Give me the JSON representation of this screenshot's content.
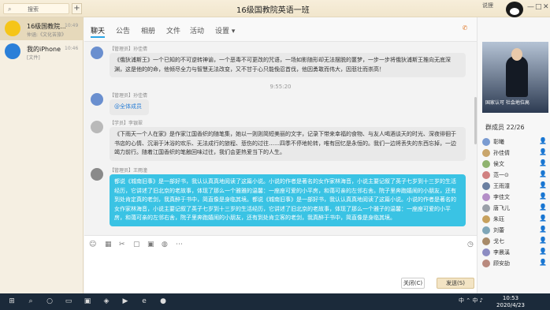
{
  "titlebar": {
    "search_icon": "search-icon",
    "search_placeholder": "搜索",
    "plus": "+",
    "title": "16级国教院英语一班",
    "profile_label": "说狸",
    "minimize": "—",
    "maximize": "□",
    "close": "✕"
  },
  "sidebar": {
    "items": [
      {
        "name": "16级国教院...",
        "sub": "仲涵:《文化苦旅》",
        "time": "10:49",
        "avatar": "#f5c518"
      },
      {
        "name": "我的iPhone",
        "sub": "[文件]",
        "time": "10:46",
        "avatar": "#2b7fd8"
      }
    ]
  },
  "header": {
    "tabs": [
      "聊天",
      "公告",
      "相册",
      "文件",
      "活动",
      "设置 ▾"
    ],
    "icons": [
      {
        "name": "phone-icon",
        "glyph": "✆",
        "color": "#e07a2b"
      },
      {
        "name": "screen-share-icon",
        "glyph": "▭",
        "color": "#e07a2b"
      },
      {
        "name": "homework-icon",
        "glyph": "课",
        "color": "#ffffff"
      },
      {
        "name": "add-icon",
        "glyph": "+",
        "color": "#ffffff"
      },
      {
        "name": "more-icon",
        "glyph": "⋯",
        "color": "#555555"
      }
    ]
  },
  "chat": {
    "messages": [
      {
        "role": "【管理员】孙佳倩",
        "text": "《俄狄浦斯王》一个已知的不可逆转神谕，一个恶毒不可更改的咒语，一场如影随形却无法摆脱的噩梦，一步一步将俄狄浦斯王推向无底深渊，这是他的的命，他倾尽全力与智慧无法改变，又不甘于心只能俛忍首伐，他因勇敢而伟大，因悲壮而崇高！",
        "style": "gray"
      },
      {
        "role": "【管理员】孙佳倩",
        "text": "@全体成员",
        "style": "link"
      },
      {
        "role": "【学员】李银翠",
        "text": "《下雨天一个人在家》是作家江国香织的随笔集，她以一则则简短美丽的文字，记录下带来幸福的食物、与友人喝酒谈天的时光、深夜徘徊于书店的心情、沉溺于沐浴的欢乐、无法成行的旅程、悲伤的过往……四季不停地轮转，唯有回忆是永恒的。我们一边将丢失的东西忘掉，一边竭力前行。随着江国香织的笔触回味过往，我们会更热爱当下的人生。",
        "style": "gray"
      },
      {
        "role": "【管理员】王雨潼",
        "text": "都说《城南旧事》是一部好书，我认认真真地阅读了这篇小说。小说的作者是著名的女作家林海音，小说主要记叙了英子七岁到十三岁的生活经历，它讲述了旧北京的老故事，体现了那么一个雅雅的温馨：一座座可爱的小平房，和蔼可亲的左邻右舍。院子里奔跑嬉闹的小朋友，还有到处肯定真的老剑，我真醉于书中，简直像是身临其境。都说《城南旧事》是一部好书，我认认真真地阅读了这篇小说。小说的作者是著名的女作家林海音，小说主要记叙了英子七岁到十三岁的生活经历，它讲述了旧北京的老故事，体现了那么一个雅子的温馨：一座座可爱的小平房，和蔼可亲的左邻右舍，院子里奔跑嬉闹的小朋友，还有到处肯立客的老剑，我真醉于书中，简直像是身临其境。",
        "style": "blue"
      }
    ],
    "timestamp": "9:55:20"
  },
  "input": {
    "tools": [
      {
        "name": "emoji-icon",
        "glyph": "☺"
      },
      {
        "name": "gif-icon",
        "glyph": "▦"
      },
      {
        "name": "scissors-icon",
        "glyph": "✂"
      },
      {
        "name": "folder-icon",
        "glyph": "▢"
      },
      {
        "name": "image-icon",
        "glyph": "▣"
      },
      {
        "name": "voice-icon",
        "glyph": "◍"
      },
      {
        "name": "more-tools-icon",
        "glyph": "⋯"
      },
      {
        "name": "history-icon",
        "glyph": "◷"
      }
    ],
    "close_label": "关闭(C)",
    "send_label": "发送(S)"
  },
  "right": {
    "tv_caption": "国家认可 社会地位高",
    "members_title": "群成员 22/26",
    "members": [
      "彰曦",
      "孙佳倩",
      "侯文",
      "范一⊙",
      "王雨潼",
      "李佳文",
      "唐飞儿",
      "朱珏",
      "刘蕾",
      "戈七",
      "李晨溪",
      "顾安劼"
    ]
  },
  "taskbar": {
    "icons": [
      "⊞",
      "⌕",
      "○",
      "▭",
      "▣",
      "◈",
      "▶",
      "e",
      "●"
    ],
    "tray": "中 ⌃ 中 ♪",
    "time": "10:53",
    "date": "2020/4/23"
  }
}
